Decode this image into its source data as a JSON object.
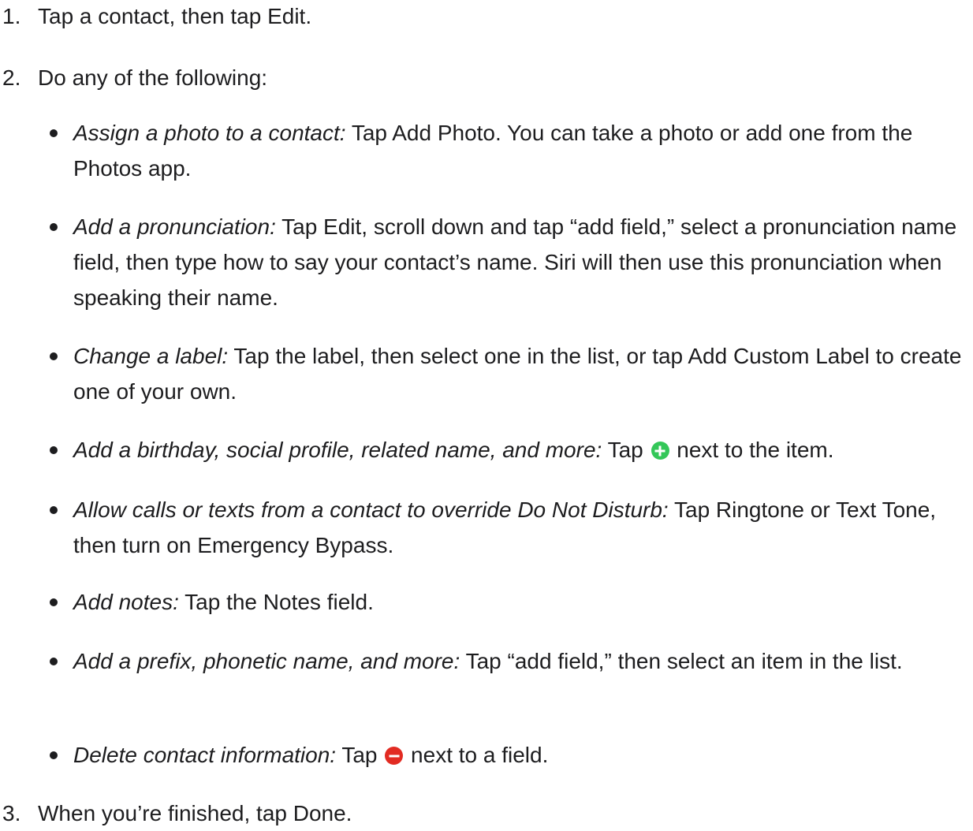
{
  "steps": [
    {
      "num": "1.",
      "text": "Tap a contact, then tap Edit."
    },
    {
      "num": "2.",
      "text": "Do any of the following:"
    },
    {
      "num": "3.",
      "text": "When you’re finished, tap Done."
    }
  ],
  "bullets": [
    {
      "label": "Assign a photo to a contact:",
      "text": " Tap Add Photo. You can take a photo or add one from the Photos app."
    },
    {
      "label": "Add a pronunciation:",
      "text": " Tap Edit, scroll down and tap “add field,” select a pronunciation name field, then type how to say your contact’s name. Siri will then use this pronunciation when speaking their name."
    },
    {
      "label": "Change a label:",
      "text": " Tap the label, then select one in the list, or tap Add Custom Label to create one of your own."
    },
    {
      "label": "Add a birthday, social profile, related name, and more:",
      "text_before": " Tap ",
      "icon": "add-circle-icon",
      "text_after": " next to the item."
    },
    {
      "label": "Allow calls or texts from a contact to override Do Not Disturb:",
      "text": " Tap Ringtone or Text Tone, then turn on Emergency Bypass."
    },
    {
      "label": "Add notes:",
      "text": " Tap the Notes field."
    },
    {
      "label": "Add a prefix, phonetic name, and more:",
      "text": " Tap “add field,” then select an item in the list."
    },
    {
      "label": "Delete contact information:",
      "text_before": " Tap ",
      "icon": "delete-circle-icon",
      "text_after": " next to a field."
    }
  ],
  "colors": {
    "text": "#1d1d1f",
    "add_icon": "#34c759",
    "delete_icon": "#e22b22"
  }
}
